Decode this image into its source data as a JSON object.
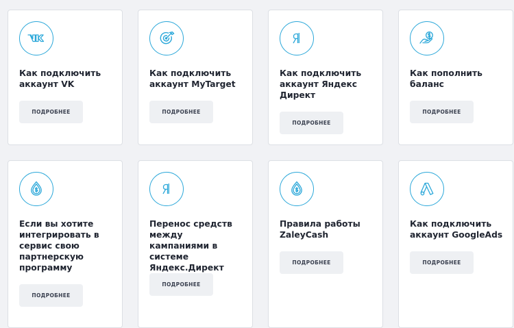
{
  "accent_color": "#2aa7d9",
  "cards": [
    {
      "icon": "vk-icon",
      "title": "Как подключить аккаунт VK",
      "button": "ПОДРОБНЕЕ"
    },
    {
      "icon": "target-icon",
      "title": "Как подключить аккаунт MyTarget",
      "button": "ПОДРОБНЕЕ"
    },
    {
      "icon": "yandex-icon",
      "title": "Как подключить аккаунт Яндекс Директ",
      "button": "ПОДРОБНЕЕ"
    },
    {
      "icon": "money-hand-icon",
      "title": "Как пополнить баланс",
      "button": "ПОДРОБНЕЕ"
    },
    {
      "icon": "dollar-drop-icon",
      "title": "Если вы хотите интегрировать в сервис свою партнерскую программу",
      "button": "ПОДРОБНЕЕ"
    },
    {
      "icon": "yandex-icon",
      "title": "Перенос средств между кампаниями в системе Яндекс.Директ",
      "button": "ПОДРОБНЕЕ"
    },
    {
      "icon": "dollar-drop-icon",
      "title": "Правила работы ZaleyCash",
      "button": "ПОДРОБНЕЕ"
    },
    {
      "icon": "google-ads-icon",
      "title": "Как подключить аккаунт GoogleAds",
      "button": "ПОДРОБНЕЕ"
    }
  ]
}
